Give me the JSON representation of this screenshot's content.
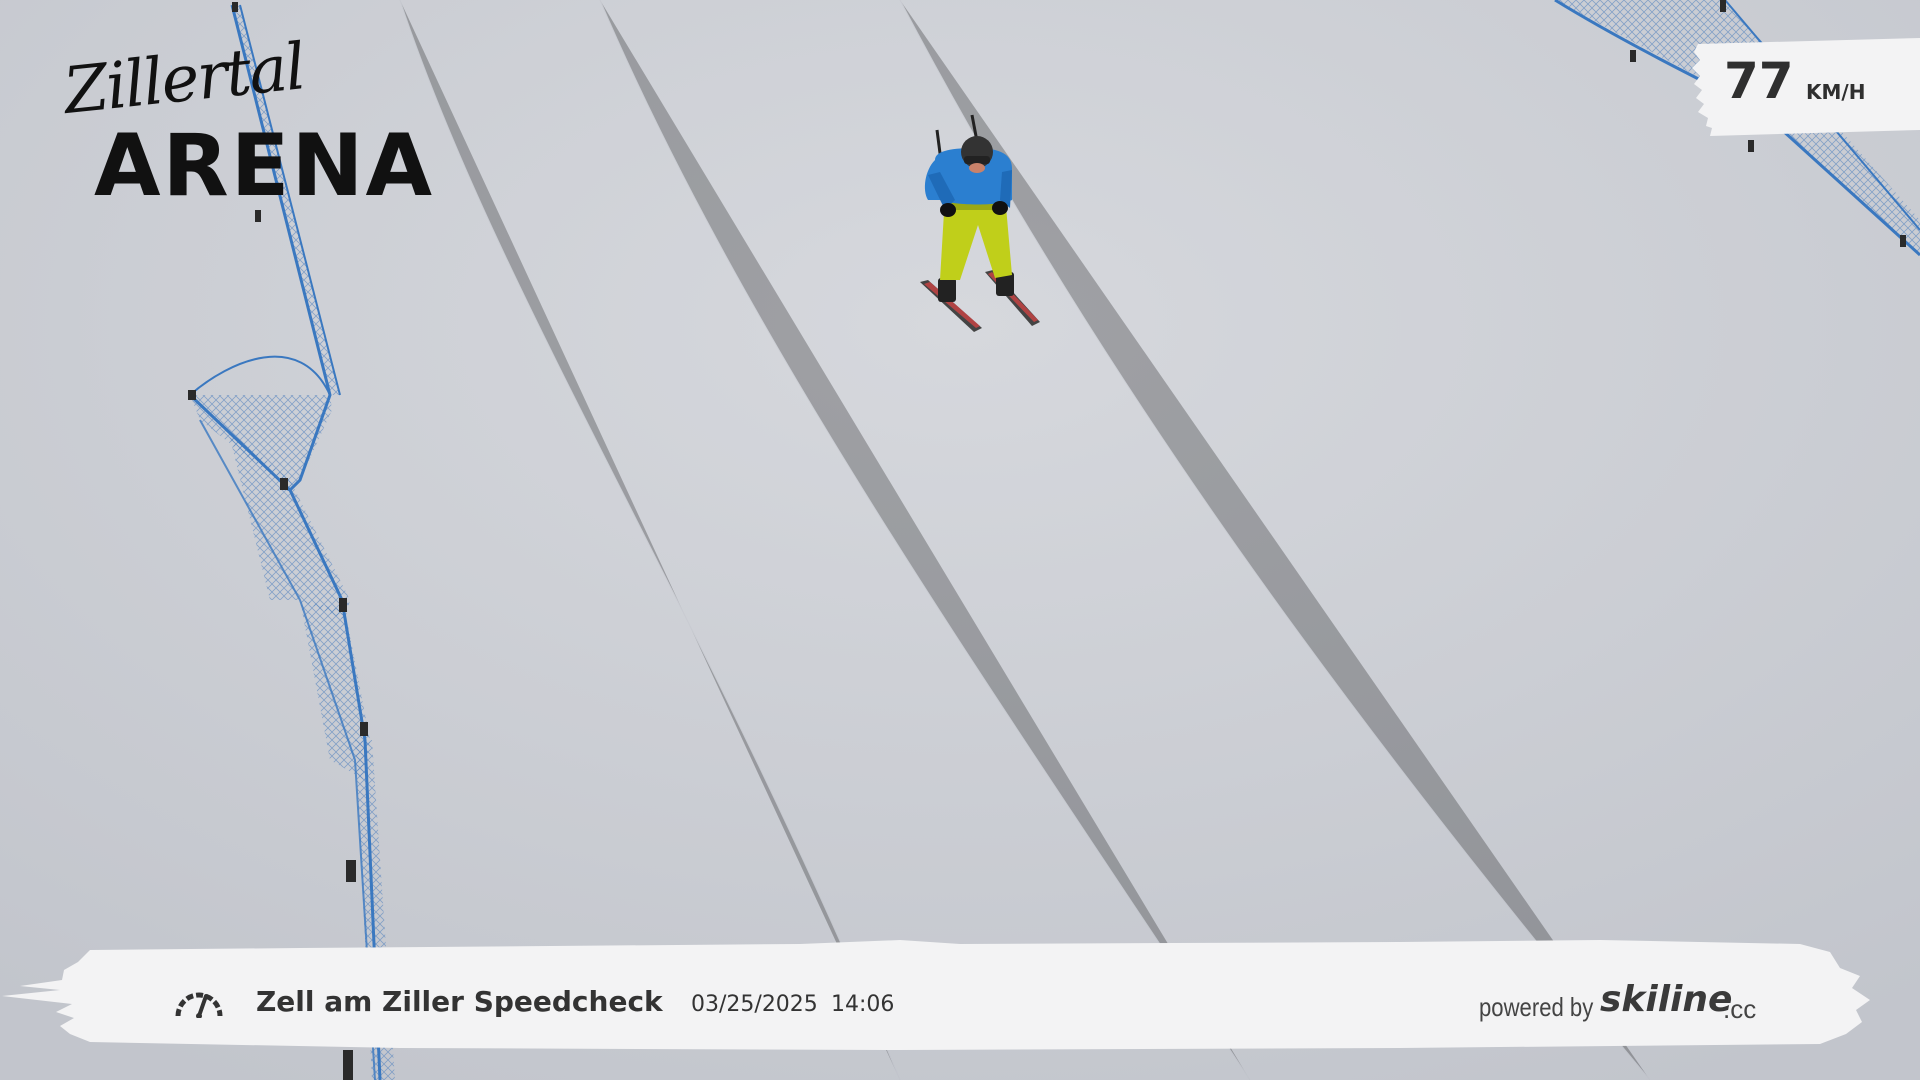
{
  "logo": {
    "script_text": "Zillertal",
    "main_text": "ARENA"
  },
  "speed": {
    "value": "77",
    "unit": "KM/H"
  },
  "info_bar": {
    "icon": "speedometer-icon",
    "location": "Zell am Ziller Speedcheck",
    "date": "03/25/2025",
    "time": "14:06",
    "powered_by": "powered by",
    "brand": "skiline",
    "brand_tld": ".cc"
  },
  "colors": {
    "snow": "#c9ccd2",
    "net_blue": "#3a78c0",
    "jacket_blue": "#2b7fd0",
    "pants_lime": "#c0cf1a",
    "badge_white": "#f3f3f4",
    "text_dark": "#333333"
  }
}
